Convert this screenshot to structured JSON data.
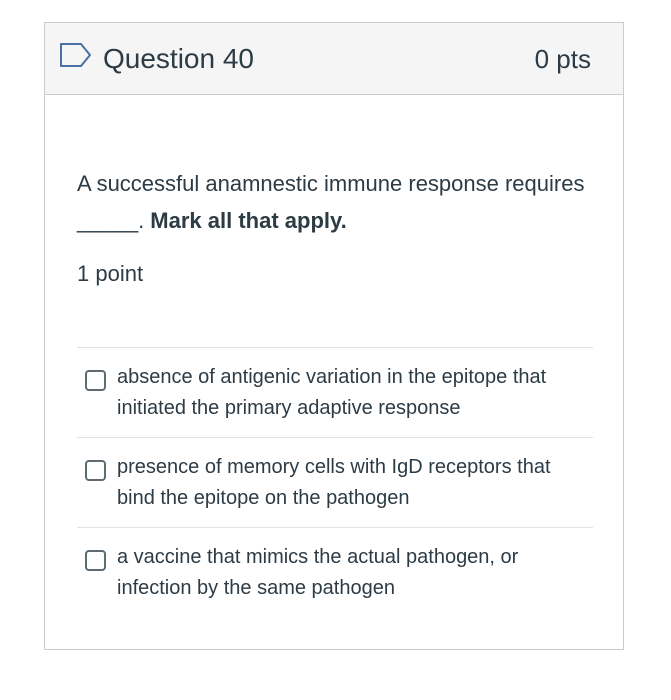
{
  "question": {
    "title": "Question 40",
    "points": "0 pts",
    "flag_icon": "flag-outline-icon",
    "text": "A successful anamnestic immune response requires _____.",
    "instruction": "Mark all that apply.",
    "point_value": "1 point"
  },
  "answers": [
    {
      "label": "absence of antigenic variation in the epitope that initiated the primary adaptive response",
      "checked": false
    },
    {
      "label": "presence of memory cells with IgD receptors that bind the epitope on the pathogen",
      "checked": false
    },
    {
      "label": "a vaccine that mimics the actual pathogen, or infection by the same pathogen",
      "checked": false
    }
  ],
  "colors": {
    "header_bg": "#f5f5f5",
    "border": "#c7cdd1",
    "text": "#2d3b45",
    "flag_stroke": "#4a6fa5"
  }
}
